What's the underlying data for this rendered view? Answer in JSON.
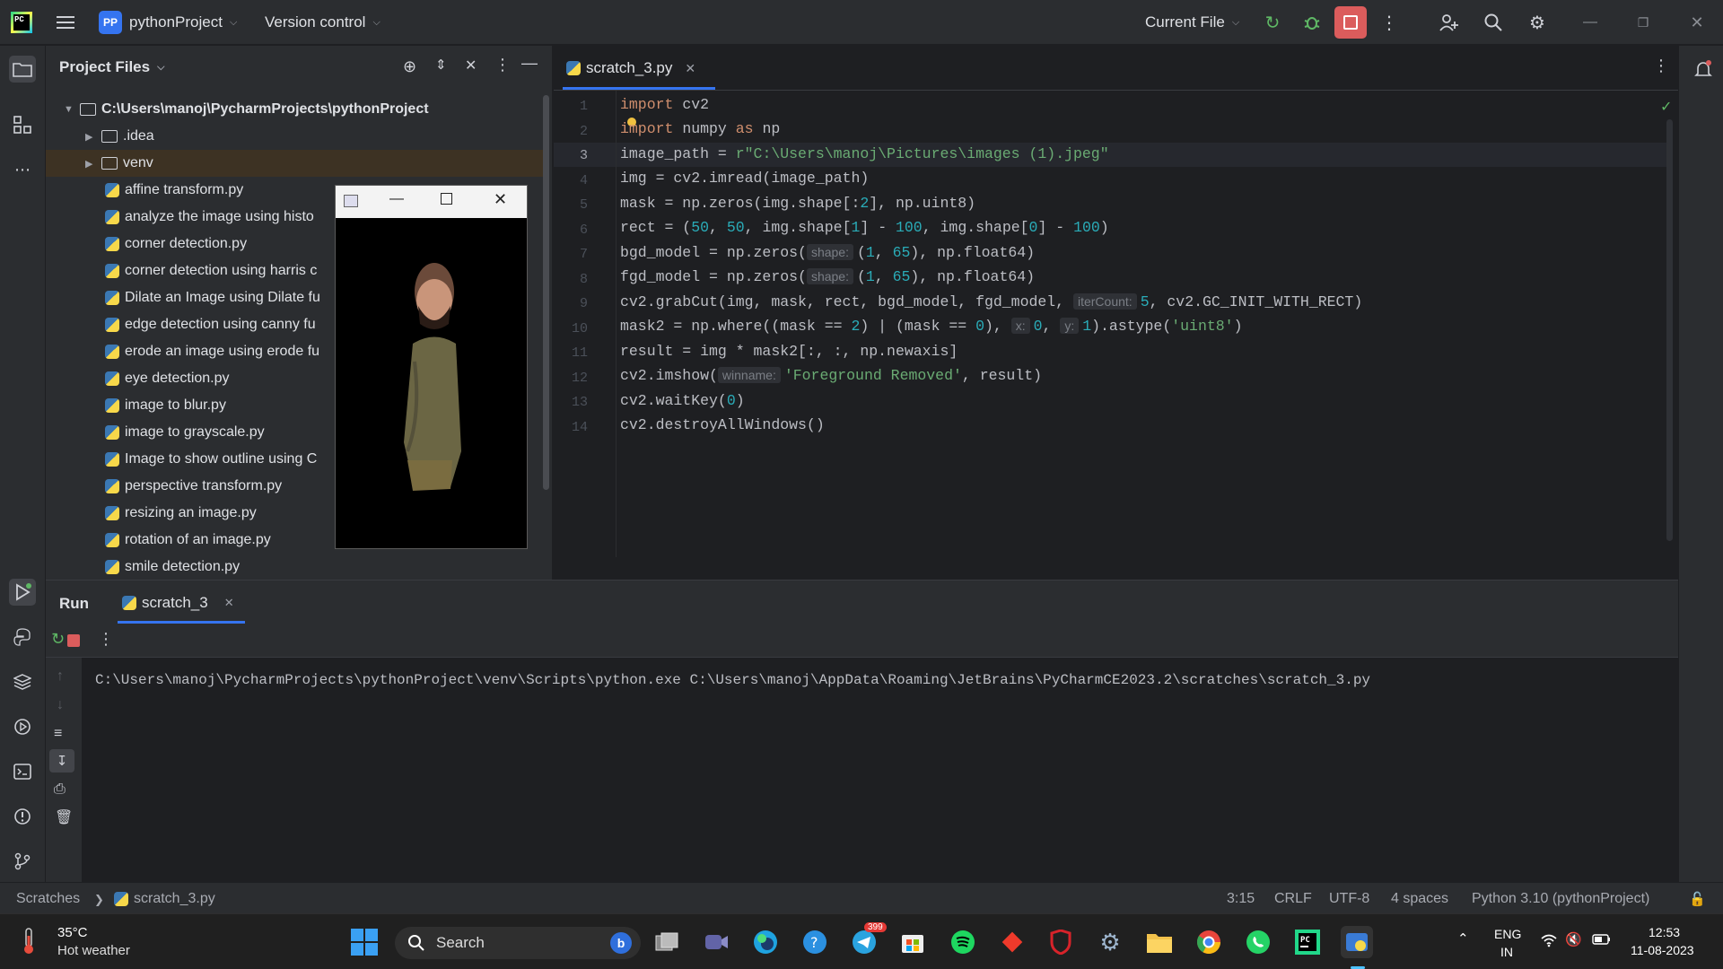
{
  "title_bar": {
    "project_badge": "PP",
    "project_name": "pythonProject",
    "vcs": "Version control",
    "run_config": "Current File"
  },
  "project_panel": {
    "header": "Project Files",
    "root": "C:\\Users\\manoj\\PycharmProjects\\pythonProject",
    "folders": [
      ".idea",
      "venv"
    ],
    "files": [
      "affine transform.py",
      "analyze the image using histo",
      "corner detection.py",
      "corner detection using harris c",
      "Dilate an Image using Dilate fu",
      "edge detection using canny fu",
      "erode an image using erode fu",
      "eye detection.py",
      "image to blur.py",
      "image to grayscale.py",
      "Image to show outline using C",
      "perspective transform.py",
      "resizing an image.py",
      "rotation of an image.py",
      "smile detection.py"
    ]
  },
  "editor": {
    "tab": "scratch_3.py",
    "line_numbers": [
      "1",
      "2",
      "3",
      "4",
      "5",
      "6",
      "7",
      "8",
      "9",
      "10",
      "11",
      "12",
      "13",
      "14"
    ],
    "current_line": "3"
  },
  "code": {
    "l1_kw": "import",
    "l1_rest": " cv2",
    "l2_kw": "import",
    "l2_mid": " numpy ",
    "l2_as": "as",
    "l2_rest": " np",
    "l3_a": "image_path = ",
    "l3_str": "r\"C:\\Users\\manoj\\Pictures\\images (1).jpeg\"",
    "l4": "img = cv2.imread(image_path)",
    "l5_a": "mask = np.zeros(img.shape[:",
    "l5_n": "2",
    "l5_b": "], np.uint8)",
    "l6_a": "rect = (",
    "l6_n1": "50",
    "l6_c": ", ",
    "l6_n2": "50",
    "l6_b": ", img.shape[",
    "l6_n3": "1",
    "l6_d": "] - ",
    "l6_n4": "100",
    "l6_e": ", img.shape[",
    "l6_n5": "0",
    "l6_f": "] - ",
    "l6_n6": "100",
    "l6_g": ")",
    "l7_a": "bgd_model = np.zeros(",
    "l7_hint": "shape:",
    "l7_b": "(",
    "l7_n1": "1",
    "l7_c": ", ",
    "l7_n2": "65",
    "l7_d": "), np.float64)",
    "l8_a": "fgd_model = np.zeros(",
    "l8_hint": "shape:",
    "l8_b": "(",
    "l8_n1": "1",
    "l8_c": ", ",
    "l8_n2": "65",
    "l8_d": "), np.float64)",
    "l9_a": "cv2.grabCut(img, mask, rect, bgd_model, fgd_model, ",
    "l9_hint": "iterCount:",
    "l9_n": "5",
    "l9_b": ", cv2.GC_INIT_WITH_RECT)",
    "l10_a": "mask2 = np.where((mask == ",
    "l10_n1": "2",
    "l10_b": ") | (mask == ",
    "l10_n2": "0",
    "l10_c": "), ",
    "l10_hx": "x:",
    "l10_n3": "0",
    "l10_d": ", ",
    "l10_hy": "y:",
    "l10_n4": "1",
    "l10_e": ").astype(",
    "l10_s": "'uint8'",
    "l10_f": ")",
    "l11": "result = img * mask2[:, :, np.newaxis]",
    "l12_a": "cv2.imshow(",
    "l12_hint": "winname:",
    "l12_s": "'Foreground Removed'",
    "l12_b": ", result)",
    "l13_a": "cv2.waitKey(",
    "l13_n": "0",
    "l13_b": ")",
    "l14": "cv2.destroyAllWindows()"
  },
  "run_panel": {
    "title": "Run",
    "tab": "scratch_3",
    "console_line": "C:\\Users\\manoj\\PycharmProjects\\pythonProject\\venv\\Scripts\\python.exe C:\\Users\\manoj\\AppData\\Roaming\\JetBrains\\PyCharmCE2023.2\\scratches\\scratch_3.py"
  },
  "status_bar": {
    "crumb_1": "Scratches",
    "crumb_2": "scratch_3.py",
    "position": "3:15",
    "line_sep": "CRLF",
    "encoding": "UTF-8",
    "indent": "4 spaces",
    "interpreter": "Python 3.10 (pythonProject)"
  },
  "taskbar": {
    "weather_temp": "35°C",
    "weather_desc": "Hot weather",
    "search": "Search",
    "telegram_badge": "399",
    "lang_1": "ENG",
    "lang_2": "IN",
    "time": "12:53",
    "date": "11-08-2023"
  },
  "colors": {
    "accent": "#3574f0",
    "stop_red": "#db5c5c",
    "keyword": "#cf8e6d",
    "string": "#6aab73",
    "number": "#2aacb8"
  }
}
